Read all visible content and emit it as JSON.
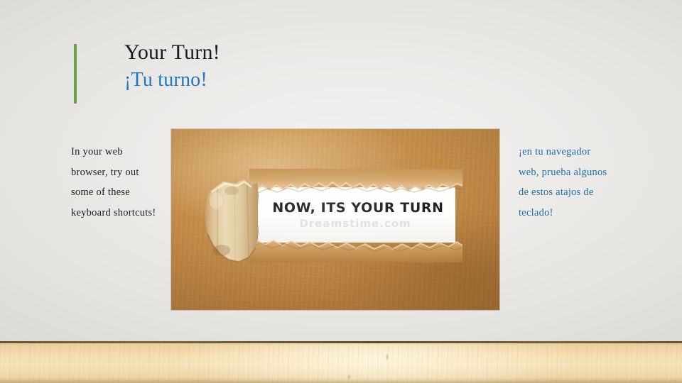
{
  "slide": {
    "background_color": "#eceae7",
    "accent_color": "#6f9f4a",
    "heading_color_en": "#1a1a1a",
    "heading_color_es": "#2077be",
    "body_color_es": "#1f6fa8"
  },
  "title": {
    "english": "Your Turn!",
    "spanish": "¡Tu turno!"
  },
  "body": {
    "english": "In your web browser, try out some of these keyboard shortcuts!",
    "spanish": "¡en tu navegador web, prueba algunos de estos atajos de teclado!"
  },
  "picture": {
    "alt_name": "torn-kraft-paper-photo",
    "revealed_text": "NOW, ITS YOUR TURN",
    "watermark_text": "Dreamstime.com",
    "kraft_color": "#bf8a48",
    "paper_color": "#ffffff"
  },
  "footer": {
    "wood_strip_color": "#f4dcae"
  }
}
